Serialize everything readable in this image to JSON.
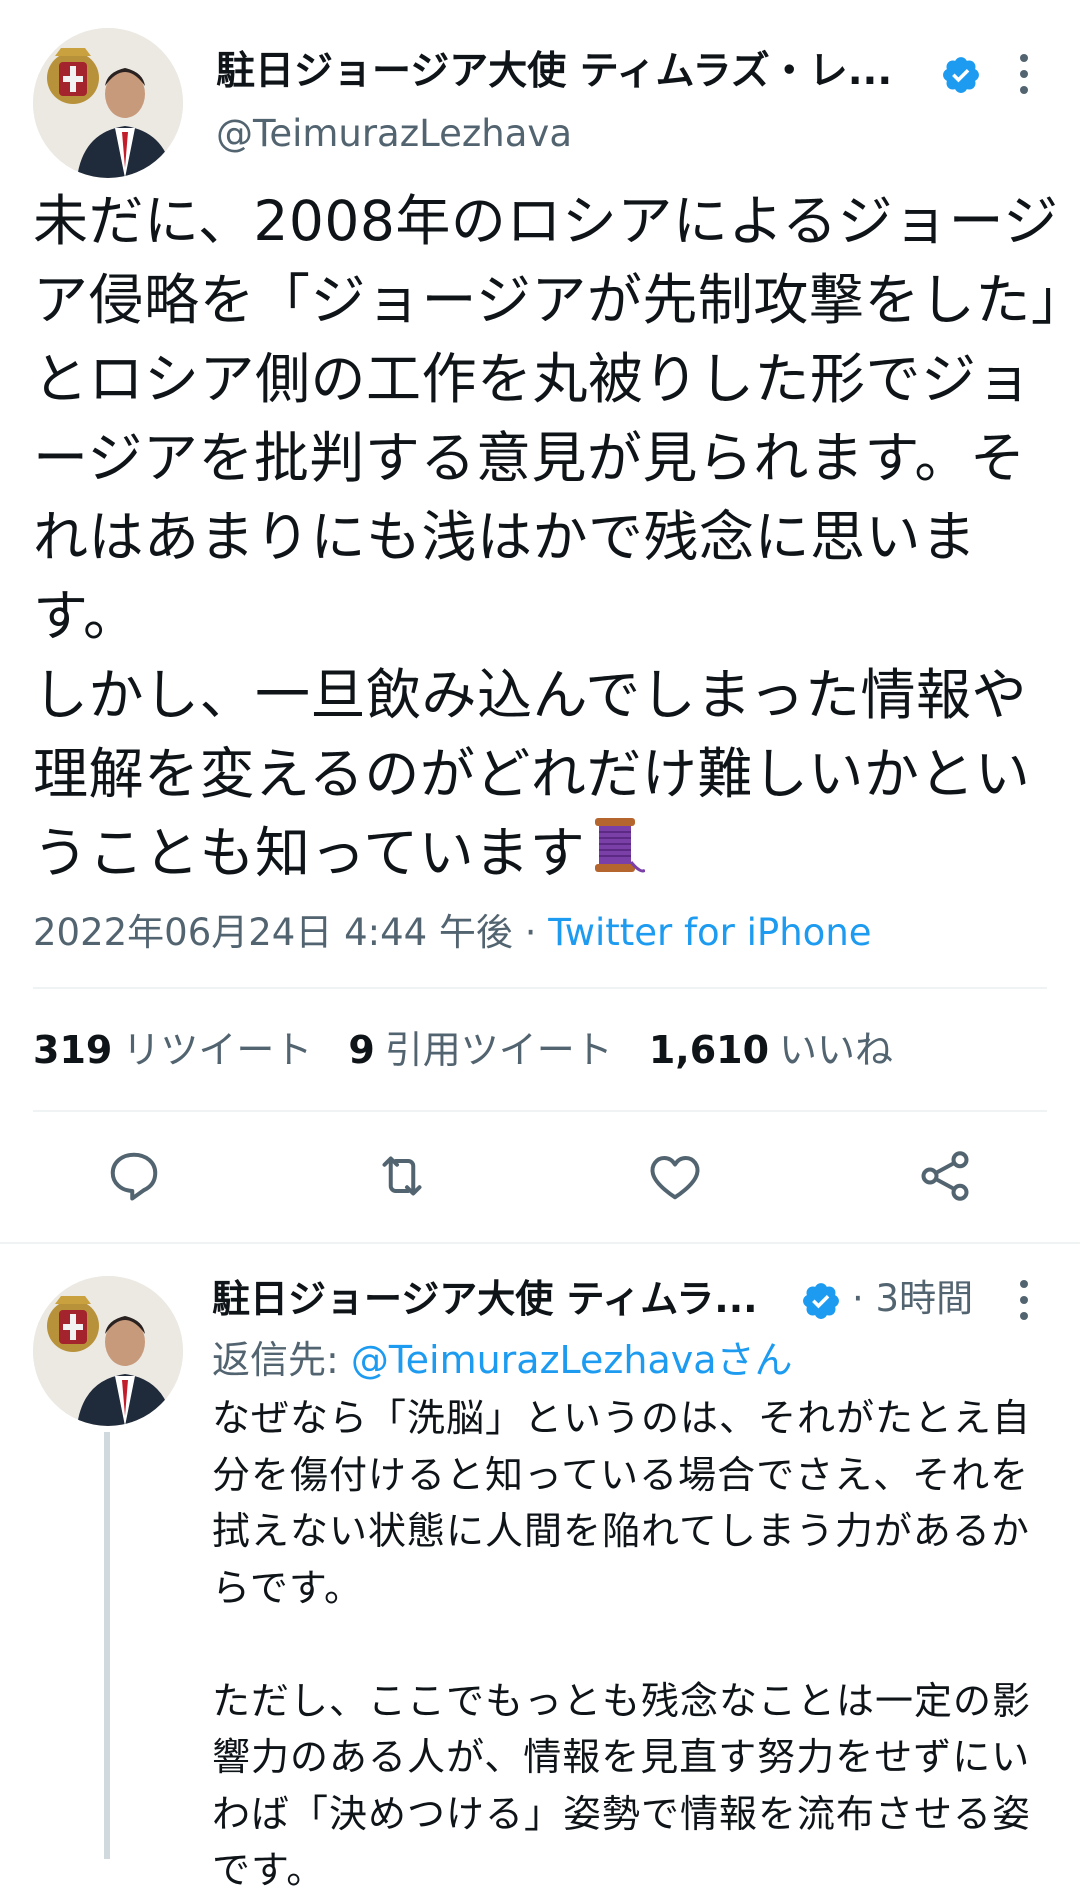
{
  "main_tweet": {
    "author_name": "駐日ジョージア大使 ティムラズ・レ...",
    "handle": "@TeimurazLezhava",
    "text": "未だに、2008年のロシアによるジョージア侵略を「ジョージアが先制攻撃をした」とロシア側の工作を丸被りした形でジョージアを批判する意見が見られます。それはあまりにも浅はかで残念に思います。\nしかし、一旦飲み込んでしまった情報や理解を変えるのがどれだけ難しいかということも知っています",
    "emoji_icon": "spool-of-thread-icon",
    "timestamp": "2022年06月24日 4:44 午後",
    "separator": " · ",
    "source": "Twitter for iPhone",
    "stats": {
      "retweets_count": "319",
      "retweets_label": "リツイート",
      "quotes_count": "9",
      "quotes_label": "引用ツイート",
      "likes_count": "1,610",
      "likes_label": "いいね"
    },
    "actions": [
      "reply-icon",
      "retweet-icon",
      "like-icon",
      "share-icon"
    ]
  },
  "reply_tweet": {
    "author_name": "駐日ジョージア大使 ティムラ...",
    "time": "· 3時間",
    "reply_to_label": "返信先: ",
    "reply_to_handle": "@TeimurazLezhavaさん",
    "text": "なぜなら「洗脳」というのは、それがたとえ自分を傷付けると知っている場合でさえ、それを拭えない状態に人間を陥れてしまう力があるからです。\n\nただし、ここでもっとも残念なことは一定の影響力のある人が、情報を見直す努力をせずにいわば「決めつける」姿勢で情報を流布させる姿です。"
  },
  "colors": {
    "text": "#0f1419",
    "secondary": "#536471",
    "accent": "#1d9bf0",
    "divider": "#eff3f4"
  }
}
